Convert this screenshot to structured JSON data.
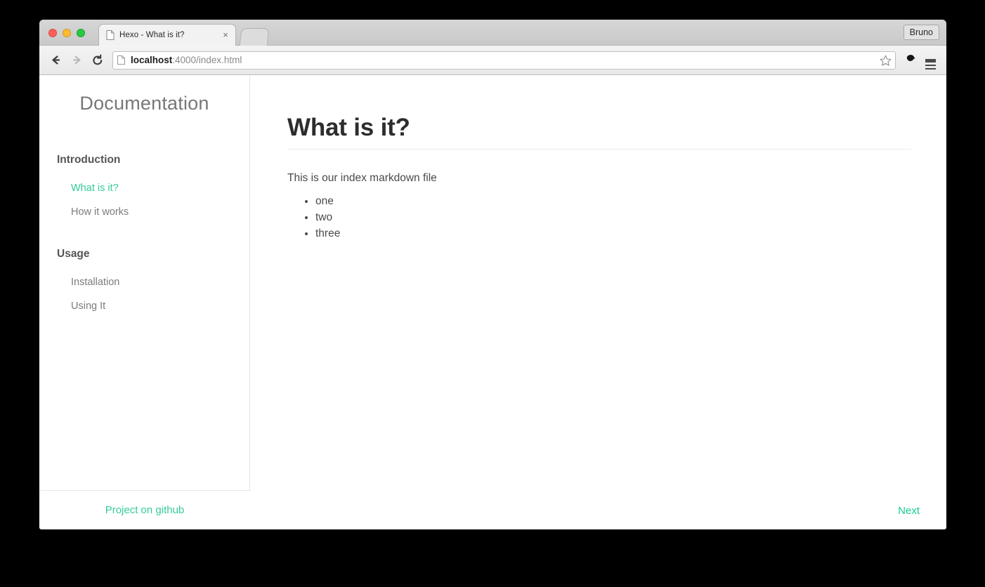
{
  "window": {
    "traffic_lights": [
      "close",
      "minimize",
      "zoom"
    ],
    "profile_label": "Bruno"
  },
  "tab": {
    "title": "Hexo - What is it?",
    "close_label": "×",
    "favicon": "page-icon"
  },
  "toolbar": {
    "back_icon": "back-arrow-icon",
    "forward_icon": "forward-arrow-icon",
    "reload_icon": "reload-icon",
    "url_host": "localhost",
    "url_rest": ":4000/index.html",
    "star_icon": "bookmark-star-icon",
    "extension_icon": "extension-icon",
    "menu_icon": "hamburger-menu-icon"
  },
  "sidebar": {
    "title": "Documentation",
    "sections": [
      {
        "heading": "Introduction",
        "links": [
          {
            "label": "What is it?",
            "active": true
          },
          {
            "label": "How it works",
            "active": false
          }
        ]
      },
      {
        "heading": "Usage",
        "links": [
          {
            "label": "Installation",
            "active": false
          },
          {
            "label": "Using It",
            "active": false
          }
        ]
      }
    ],
    "footer_link": "Project on github"
  },
  "main": {
    "heading": "What is it?",
    "paragraph": "This is our index markdown file",
    "bullets": [
      "one",
      "two",
      "three"
    ],
    "next_label": "Next"
  },
  "colors": {
    "accent_green": "#35cd96",
    "next_green": "#19cf8d",
    "heading_dark": "#2d2d2d",
    "body_text": "#4a4a4a",
    "nav_text": "#7c7c7c",
    "page_bg": "#ffffff",
    "desktop_bg": "#000000"
  }
}
